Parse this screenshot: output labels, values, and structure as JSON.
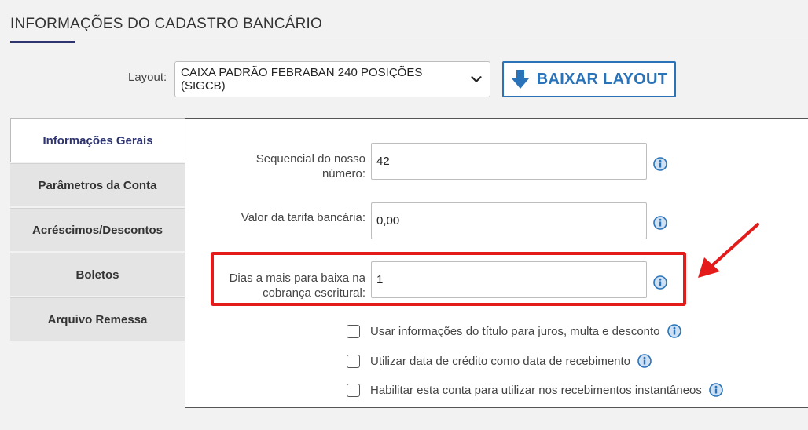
{
  "header": {
    "title": "INFORMAÇÕES DO CADASTRO BANCÁRIO"
  },
  "layout": {
    "label": "Layout:",
    "selected": "CAIXA PADRÃO FEBRABAN 240 POSIÇÕES (SIGCB)",
    "download_label": "BAIXAR LAYOUT"
  },
  "tabs": [
    {
      "label": "Informações Gerais",
      "active": true
    },
    {
      "label": "Parâmetros da Conta",
      "active": false
    },
    {
      "label": "Acréscimos/Descontos",
      "active": false
    },
    {
      "label": "Boletos",
      "active": false
    },
    {
      "label": "Arquivo Remessa",
      "active": false
    }
  ],
  "fields": [
    {
      "label_line1": "Sequencial do nosso",
      "label_line2": "número:",
      "value": "42"
    },
    {
      "label_line1": "",
      "label_line2": "Valor da tarifa bancária:",
      "value": "0,00"
    },
    {
      "label_line1": "Dias a mais para baixa na",
      "label_line2": "cobrança escritural:",
      "value": "1"
    }
  ],
  "checkboxes": [
    {
      "label": "Usar informações do título para juros, multa e desconto",
      "checked": false
    },
    {
      "label": "Utilizar data de crédito como data de recebimento",
      "checked": false
    },
    {
      "label": "Habilitar esta conta para utilizar nos recebimentos instantâneos",
      "checked": false
    }
  ],
  "colors": {
    "accent": "#2d3470",
    "button": "#2a73b8",
    "highlight": "#e31b1b",
    "info_icon": "#2a73b8"
  },
  "icons": {
    "select": "chevron-down-icon",
    "download": "arrow-down-icon",
    "info": "info-icon",
    "annotation": "red-arrow-icon"
  }
}
